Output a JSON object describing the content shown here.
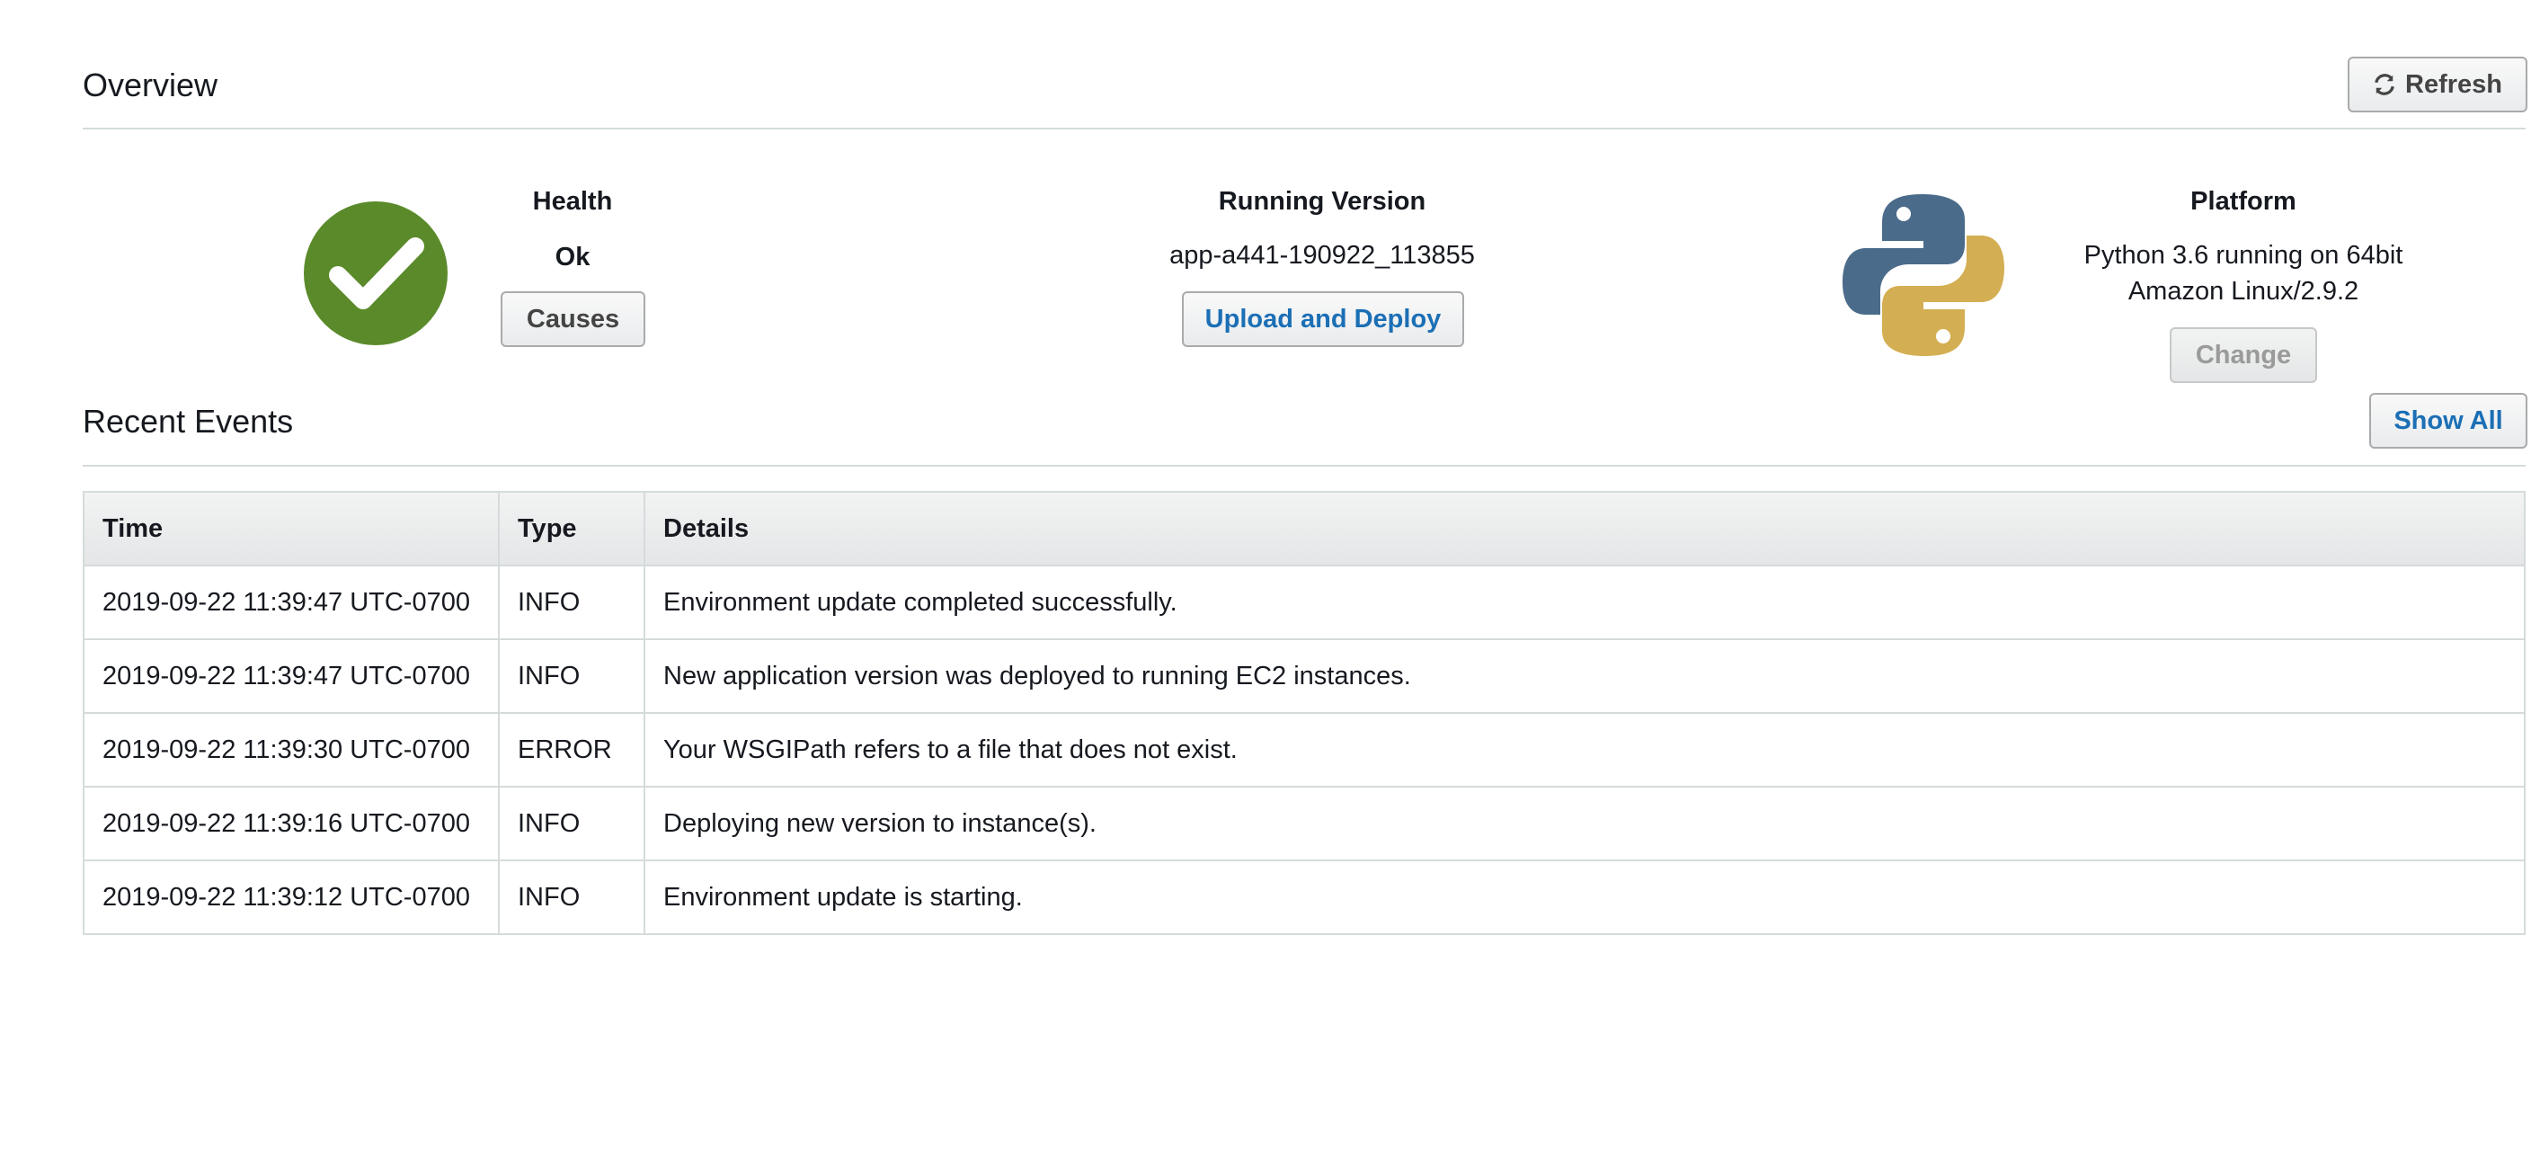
{
  "overview": {
    "title": "Overview",
    "refresh_label": "Refresh"
  },
  "health": {
    "label": "Health",
    "value": "Ok",
    "causes_label": "Causes",
    "status_color": "#5a8a2a"
  },
  "running_version": {
    "label": "Running Version",
    "value": "app-a441-190922_113855",
    "upload_label": "Upload and Deploy"
  },
  "platform": {
    "label": "Platform",
    "line1": "Python 3.6 running on 64bit",
    "line2": "Amazon Linux/2.9.2",
    "change_label": "Change",
    "icon": "python-logo-icon"
  },
  "recent_events": {
    "title": "Recent Events",
    "show_all_label": "Show All",
    "columns": {
      "time": "Time",
      "type": "Type",
      "details": "Details"
    },
    "rows": [
      {
        "time": "2019-09-22 11:39:47 UTC-0700",
        "type": "INFO",
        "details": "Environment update completed successfully."
      },
      {
        "time": "2019-09-22 11:39:47 UTC-0700",
        "type": "INFO",
        "details": "New application version was deployed to running EC2 instances."
      },
      {
        "time": "2019-09-22 11:39:30 UTC-0700",
        "type": "ERROR",
        "details": "Your WSGIPath refers to a file that does not exist."
      },
      {
        "time": "2019-09-22 11:39:16 UTC-0700",
        "type": "INFO",
        "details": "Deploying new version to instance(s)."
      },
      {
        "time": "2019-09-22 11:39:12 UTC-0700",
        "type": "INFO",
        "details": "Environment update is starting."
      }
    ]
  },
  "colors": {
    "info": "#5a8a1d",
    "error": "#c0392b",
    "link_blue": "#1b6fb5"
  }
}
